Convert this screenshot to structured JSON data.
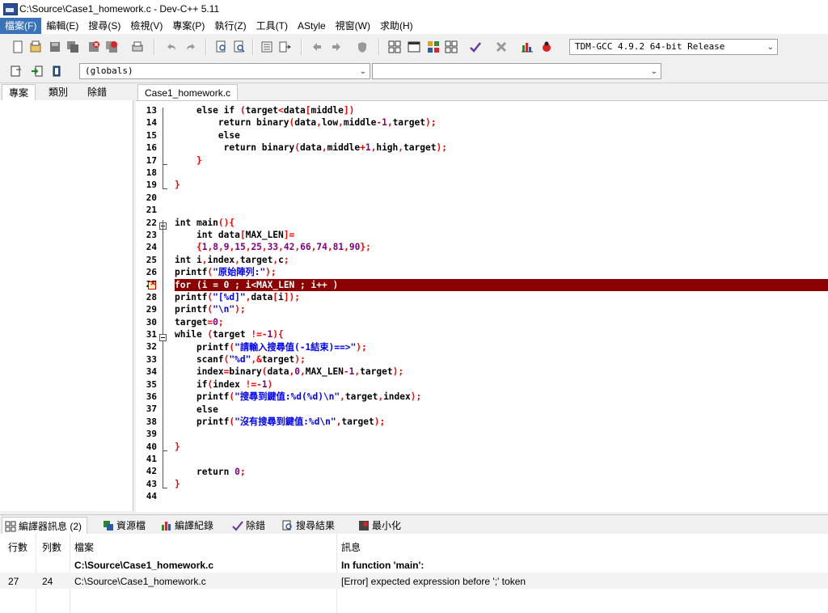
{
  "window": {
    "title": "C:\\Source\\Case1_homework.c - Dev-C++ 5.11"
  },
  "menu": [
    "檔案(F)",
    "編輯(E)",
    "搜尋(S)",
    "檢視(V)",
    "專案(P)",
    "執行(Z)",
    "工具(T)",
    "AStyle",
    "視窗(W)",
    "求助(H)"
  ],
  "toolbar": {
    "compiler_select": "TDM-GCC 4.9.2 64-bit Release",
    "scope_select": "(globals)"
  },
  "left_panel": {
    "tabs": [
      "專案",
      "類別",
      "除錯"
    ]
  },
  "editor": {
    "tab": "Case1_homework.c",
    "lines": [
      {
        "n": "13",
        "segments": [
          [
            "",
            "    "
          ],
          [
            "kw",
            "else if "
          ],
          [
            "sym",
            "("
          ],
          [
            "",
            "target"
          ],
          [
            "sym",
            "<"
          ],
          [
            "",
            "data"
          ],
          [
            "sym",
            "["
          ],
          [
            "",
            "middle"
          ],
          [
            "sym",
            "])"
          ]
        ]
      },
      {
        "n": "14",
        "segments": [
          [
            "",
            "        "
          ],
          [
            "kw",
            "return "
          ],
          [
            "",
            "binary"
          ],
          [
            "sym",
            "("
          ],
          [
            "",
            "data"
          ],
          [
            "sym",
            ","
          ],
          [
            "",
            "low"
          ],
          [
            "sym",
            ","
          ],
          [
            "",
            "middle"
          ],
          [
            "sym",
            "-"
          ],
          [
            "num",
            "1"
          ],
          [
            "sym",
            ","
          ],
          [
            "",
            "target"
          ],
          [
            "sym",
            ");"
          ]
        ]
      },
      {
        "n": "15",
        "segments": [
          [
            "",
            "        "
          ],
          [
            "kw",
            "else"
          ]
        ]
      },
      {
        "n": "16",
        "segments": [
          [
            "",
            "         "
          ],
          [
            "kw",
            "return "
          ],
          [
            "",
            "binary"
          ],
          [
            "sym",
            "("
          ],
          [
            "",
            "data"
          ],
          [
            "sym",
            ","
          ],
          [
            "",
            "middle"
          ],
          [
            "sym",
            "+"
          ],
          [
            "num",
            "1"
          ],
          [
            "sym",
            ","
          ],
          [
            "",
            "high"
          ],
          [
            "sym",
            ","
          ],
          [
            "",
            "target"
          ],
          [
            "sym",
            ");"
          ]
        ]
      },
      {
        "n": "17",
        "segments": [
          [
            "",
            "    "
          ],
          [
            "sym",
            "}"
          ]
        ]
      },
      {
        "n": "18",
        "segments": []
      },
      {
        "n": "19",
        "segments": [
          [
            "sym",
            "}"
          ]
        ]
      },
      {
        "n": "20",
        "segments": []
      },
      {
        "n": "21",
        "segments": []
      },
      {
        "n": "22",
        "segments": [
          [
            "kw",
            "int "
          ],
          [
            "",
            "main"
          ],
          [
            "sym",
            "(){"
          ]
        ]
      },
      {
        "n": "23",
        "segments": [
          [
            "",
            "    "
          ],
          [
            "kw",
            "int "
          ],
          [
            "",
            "data"
          ],
          [
            "sym",
            "["
          ],
          [
            "",
            "MAX_LEN"
          ],
          [
            "sym",
            "]="
          ]
        ]
      },
      {
        "n": "24",
        "segments": [
          [
            "",
            "    "
          ],
          [
            "sym",
            "{"
          ],
          [
            "num",
            "1"
          ],
          [
            "sym",
            ","
          ],
          [
            "num",
            "8"
          ],
          [
            "sym",
            ","
          ],
          [
            "num",
            "9"
          ],
          [
            "sym",
            ","
          ],
          [
            "num",
            "15"
          ],
          [
            "sym",
            ","
          ],
          [
            "num",
            "25"
          ],
          [
            "sym",
            ","
          ],
          [
            "num",
            "33"
          ],
          [
            "sym",
            ","
          ],
          [
            "num",
            "42"
          ],
          [
            "sym",
            ","
          ],
          [
            "num",
            "66"
          ],
          [
            "sym",
            ","
          ],
          [
            "num",
            "74"
          ],
          [
            "sym",
            ","
          ],
          [
            "num",
            "81"
          ],
          [
            "sym",
            ","
          ],
          [
            "num",
            "90"
          ],
          [
            "sym",
            "};"
          ]
        ]
      },
      {
        "n": "25",
        "segments": [
          [
            "kw",
            "int "
          ],
          [
            "",
            "i"
          ],
          [
            "sym",
            ","
          ],
          [
            "",
            "index"
          ],
          [
            "sym",
            ","
          ],
          [
            "",
            "target"
          ],
          [
            "sym",
            ","
          ],
          [
            "",
            "c"
          ],
          [
            "sym",
            ";"
          ]
        ]
      },
      {
        "n": "26",
        "segments": [
          [
            "",
            "printf"
          ],
          [
            "sym",
            "("
          ],
          [
            "str",
            "\"原始陣列:\""
          ],
          [
            "sym",
            ");"
          ]
        ]
      },
      {
        "n": "27",
        "error": true,
        "segments": [
          [
            "kw",
            "for "
          ],
          [
            "sym",
            "("
          ],
          [
            "",
            "i "
          ],
          [
            "sym",
            "= "
          ],
          [
            "num",
            "0 "
          ],
          [
            "sym",
            "; "
          ],
          [
            "",
            "i"
          ],
          [
            "sym",
            "<"
          ],
          [
            "",
            "MAX_LEN "
          ],
          [
            "sym",
            "; "
          ],
          [
            "",
            "i"
          ],
          [
            "sym",
            "++ )"
          ]
        ]
      },
      {
        "n": "28",
        "segments": [
          [
            "",
            "printf"
          ],
          [
            "sym",
            "("
          ],
          [
            "str",
            "\"[%d]\""
          ],
          [
            "sym",
            ","
          ],
          [
            "",
            "data"
          ],
          [
            "sym",
            "["
          ],
          [
            "",
            "i"
          ],
          [
            "sym",
            "]);"
          ]
        ]
      },
      {
        "n": "29",
        "segments": [
          [
            "",
            "printf"
          ],
          [
            "sym",
            "("
          ],
          [
            "str",
            "\"\\n\""
          ],
          [
            "sym",
            ");"
          ]
        ]
      },
      {
        "n": "30",
        "segments": [
          [
            "",
            "target"
          ],
          [
            "sym",
            "="
          ],
          [
            "num",
            "0"
          ],
          [
            "sym",
            ";"
          ]
        ]
      },
      {
        "n": "31",
        "segments": [
          [
            "kw",
            "while "
          ],
          [
            "sym",
            "("
          ],
          [
            "",
            "target "
          ],
          [
            "sym",
            "!=-"
          ],
          [
            "num",
            "1"
          ],
          [
            "sym",
            "){"
          ]
        ]
      },
      {
        "n": "32",
        "segments": [
          [
            "",
            "    printf"
          ],
          [
            "sym",
            "("
          ],
          [
            "str",
            "\"請輸入搜尋值(-1結束)==>\""
          ],
          [
            "sym",
            ");"
          ]
        ]
      },
      {
        "n": "33",
        "segments": [
          [
            "",
            "    scanf"
          ],
          [
            "sym",
            "("
          ],
          [
            "str",
            "\"%d\""
          ],
          [
            "sym",
            ",&"
          ],
          [
            "",
            "target"
          ],
          [
            "sym",
            ");"
          ]
        ]
      },
      {
        "n": "34",
        "segments": [
          [
            "",
            "    index"
          ],
          [
            "sym",
            "="
          ],
          [
            "",
            "binary"
          ],
          [
            "sym",
            "("
          ],
          [
            "",
            "data"
          ],
          [
            "sym",
            ","
          ],
          [
            "num",
            "0"
          ],
          [
            "sym",
            ","
          ],
          [
            "",
            "MAX_LEN"
          ],
          [
            "sym",
            "-"
          ],
          [
            "num",
            "1"
          ],
          [
            "sym",
            ","
          ],
          [
            "",
            "target"
          ],
          [
            "sym",
            ");"
          ]
        ]
      },
      {
        "n": "35",
        "segments": [
          [
            "",
            "    "
          ],
          [
            "kw",
            "if"
          ],
          [
            "sym",
            "("
          ],
          [
            "",
            "index "
          ],
          [
            "sym",
            "!=-"
          ],
          [
            "num",
            "1"
          ],
          [
            "sym",
            ")"
          ]
        ]
      },
      {
        "n": "36",
        "segments": [
          [
            "",
            "    printf"
          ],
          [
            "sym",
            "("
          ],
          [
            "str",
            "\"搜尋到鍵值:%d(%d)\\n\""
          ],
          [
            "sym",
            ","
          ],
          [
            "",
            "target"
          ],
          [
            "sym",
            ","
          ],
          [
            "",
            "index"
          ],
          [
            "sym",
            ");"
          ]
        ]
      },
      {
        "n": "37",
        "segments": [
          [
            "",
            "    "
          ],
          [
            "kw",
            "else"
          ]
        ]
      },
      {
        "n": "38",
        "segments": [
          [
            "",
            "    printf"
          ],
          [
            "sym",
            "("
          ],
          [
            "str",
            "\"沒有搜尋到鍵值:%d\\n\""
          ],
          [
            "sym",
            ","
          ],
          [
            "",
            "target"
          ],
          [
            "sym",
            ");"
          ]
        ]
      },
      {
        "n": "39",
        "segments": []
      },
      {
        "n": "40",
        "segments": [
          [
            "sym",
            "}"
          ]
        ]
      },
      {
        "n": "41",
        "segments": []
      },
      {
        "n": "42",
        "segments": [
          [
            "",
            "    "
          ],
          [
            "kw",
            "return "
          ],
          [
            "num",
            "0"
          ],
          [
            "sym",
            ";"
          ]
        ]
      },
      {
        "n": "43",
        "segments": [
          [
            "sym",
            "}"
          ]
        ]
      },
      {
        "n": "44",
        "segments": []
      }
    ]
  },
  "bottom_panel": {
    "tabs": [
      "編譯器訊息 (2)",
      "資源檔",
      "編譯紀錄",
      "除錯",
      "搜尋結果",
      "最小化"
    ],
    "columns": [
      "行數",
      "列數",
      "檔案",
      "訊息"
    ],
    "rows": [
      {
        "line": "",
        "col": "",
        "file": "C:\\Source\\Case1_homework.c",
        "message": "In function 'main':",
        "bold": true
      },
      {
        "line": "27",
        "col": "24",
        "file": "C:\\Source\\Case1_homework.c",
        "message": "[Error] expected expression before ';' token",
        "bold": false
      }
    ]
  }
}
